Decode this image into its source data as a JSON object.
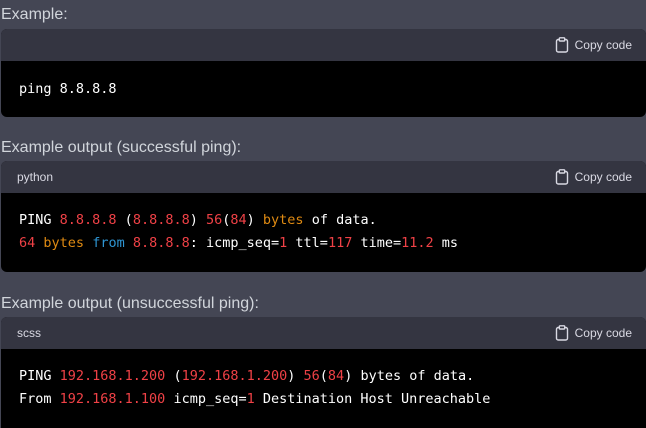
{
  "sections": [
    {
      "heading": "Example:",
      "lang": "",
      "copy_label": "Copy code",
      "lines": [
        [
          {
            "text": "ping 8.8.8.8",
            "color": "plain"
          }
        ]
      ]
    },
    {
      "heading": "Example output (successful ping):",
      "lang": "python",
      "copy_label": "Copy code",
      "lines": [
        [
          {
            "text": "PING ",
            "color": "plain"
          },
          {
            "text": "8.8.8.8",
            "color": "red"
          },
          {
            "text": " (",
            "color": "plain"
          },
          {
            "text": "8.8.8.8",
            "color": "red"
          },
          {
            "text": ") ",
            "color": "plain"
          },
          {
            "text": "56",
            "color": "red"
          },
          {
            "text": "(",
            "color": "plain"
          },
          {
            "text": "84",
            "color": "red"
          },
          {
            "text": ") ",
            "color": "plain"
          },
          {
            "text": "bytes",
            "color": "orange"
          },
          {
            "text": " of data.",
            "color": "plain"
          }
        ],
        [
          {
            "text": "64",
            "color": "red"
          },
          {
            "text": " ",
            "color": "plain"
          },
          {
            "text": "bytes",
            "color": "orange"
          },
          {
            "text": " ",
            "color": "plain"
          },
          {
            "text": "from",
            "color": "blue"
          },
          {
            "text": " ",
            "color": "plain"
          },
          {
            "text": "8.8.8.8",
            "color": "red"
          },
          {
            "text": ": icmp_seq=",
            "color": "plain"
          },
          {
            "text": "1",
            "color": "red"
          },
          {
            "text": " ttl=",
            "color": "plain"
          },
          {
            "text": "117",
            "color": "red"
          },
          {
            "text": " time=",
            "color": "plain"
          },
          {
            "text": "11.2",
            "color": "red"
          },
          {
            "text": " ms",
            "color": "plain"
          }
        ]
      ]
    },
    {
      "heading": "Example output (unsuccessful ping):",
      "lang": "scss",
      "copy_label": "Copy code",
      "lines": [
        [
          {
            "text": "PING ",
            "color": "plain"
          },
          {
            "text": "192.168.1.200",
            "color": "red"
          },
          {
            "text": " (",
            "color": "plain"
          },
          {
            "text": "192.168.1.200",
            "color": "red"
          },
          {
            "text": ") ",
            "color": "plain"
          },
          {
            "text": "56",
            "color": "red"
          },
          {
            "text": "(",
            "color": "plain"
          },
          {
            "text": "84",
            "color": "red"
          },
          {
            "text": ") bytes of data.",
            "color": "plain"
          }
        ],
        [
          {
            "text": "From ",
            "color": "plain"
          },
          {
            "text": "192.168.1.100",
            "color": "red"
          },
          {
            "text": " icmp_seq=",
            "color": "plain"
          },
          {
            "text": "1",
            "color": "red"
          },
          {
            "text": " Destination Host Unreachable",
            "color": "plain"
          }
        ]
      ]
    }
  ],
  "colors": {
    "background": "#444654",
    "header": "#343541",
    "code_bg": "#000000",
    "plain": "#ffffff",
    "red": "#ef4146",
    "orange": "#df8a12",
    "blue": "#2e95d3"
  }
}
